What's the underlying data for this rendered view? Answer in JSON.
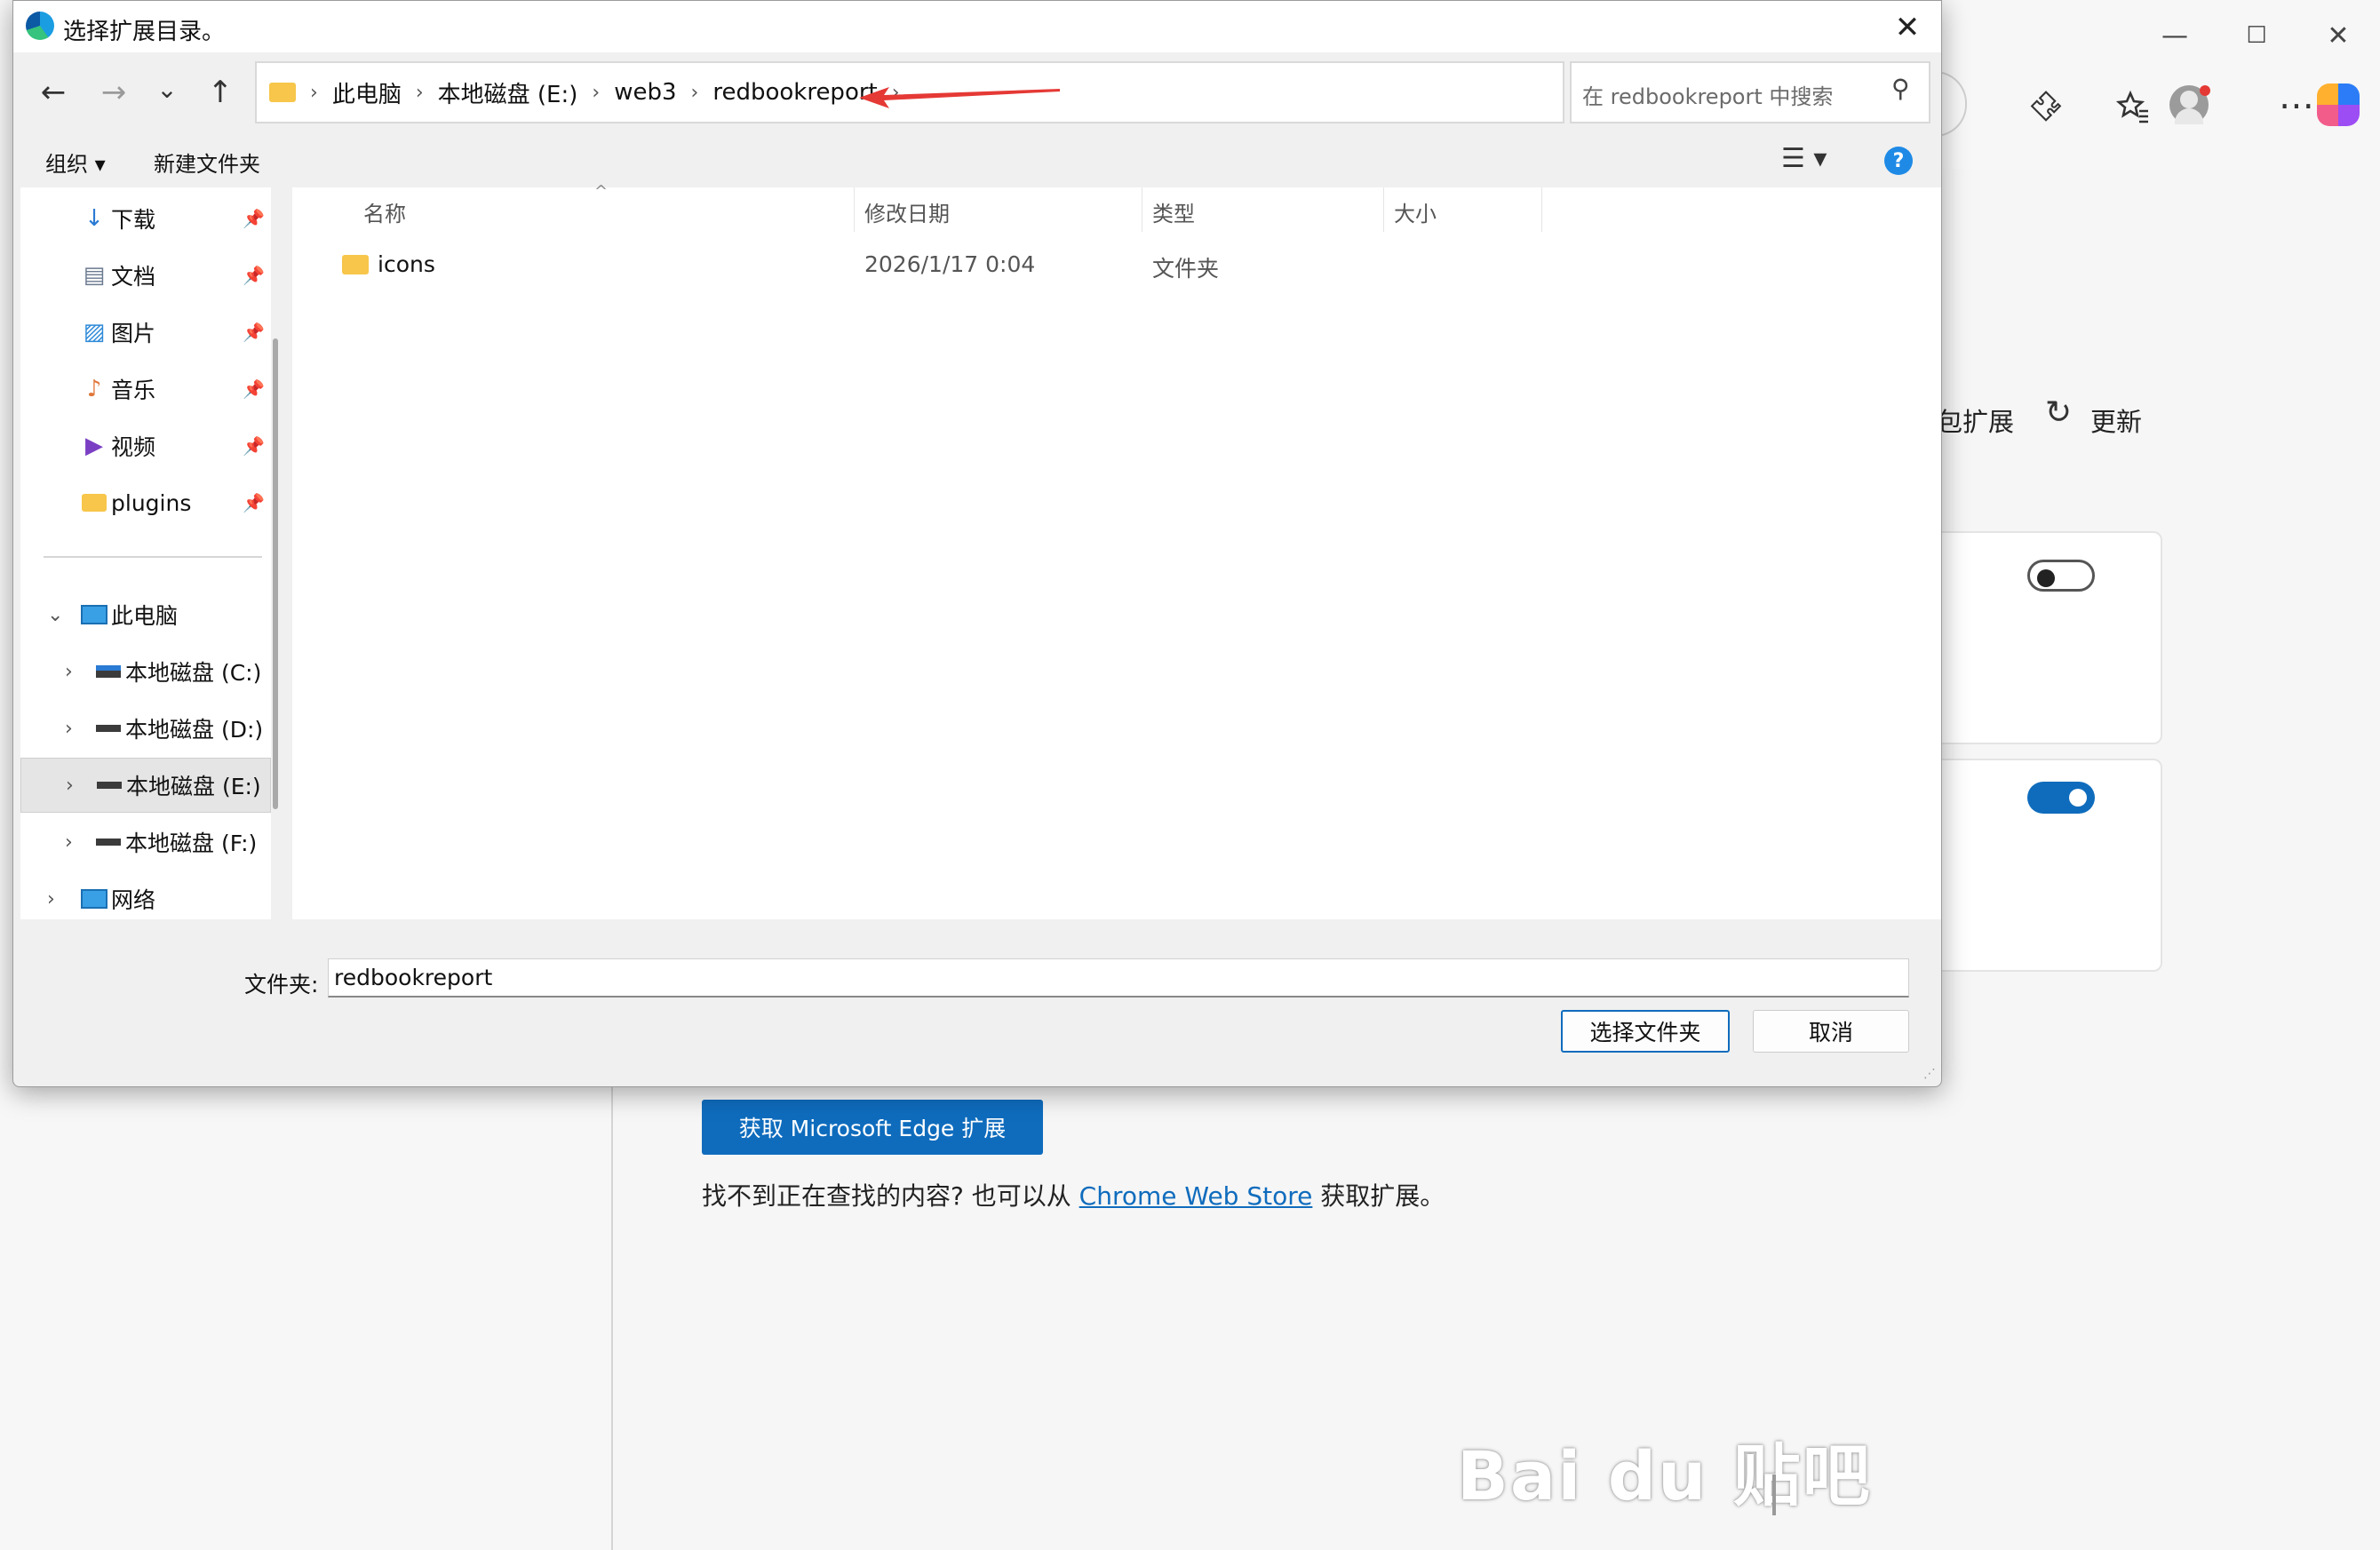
{
  "browser": {
    "window_controls": {
      "minimize": "—",
      "maximize": "☐",
      "close": "✕"
    },
    "toolbar_icons": [
      "extensions-icon",
      "favorites-icon",
      "profile-avatar",
      "more-icon",
      "copilot-icon"
    ],
    "more_glyph": "⋯"
  },
  "extensions_page": {
    "header_partial": "包扩展",
    "refresh_label": "更新",
    "refresh_glyph": "↻",
    "cards": [
      {
        "toggle": "off"
      },
      {
        "toggle": "on"
      }
    ],
    "get_extensions_button": "获取 Microsoft Edge 扩展",
    "not_found_prefix": "找不到正在查找的内容? 也可以从 ",
    "chrome_store_link": "Chrome Web Store",
    "not_found_suffix": " 获取扩展。",
    "accent_color": "#0f6cbd"
  },
  "watermark": "Bai du 贴吧",
  "dialog": {
    "title": "选择扩展目录。",
    "close_glyph": "✕",
    "nav": {
      "back": "←",
      "forward": "→",
      "recent": "⌄",
      "up": "↑"
    },
    "breadcrumb": [
      "此电脑",
      "本地磁盘 (E:)",
      "web3",
      "redbookreport"
    ],
    "breadcrumb_sep": "›",
    "address_dropdown": "⌄",
    "address_refresh": "↻",
    "search_placeholder": "在 redbookreport 中搜索",
    "search_glyph": "⚲",
    "toolbar": {
      "organize": "组织 ▾",
      "new_folder": "新建文件夹",
      "view": "☰ ▾",
      "help": "?"
    },
    "quick_access": [
      {
        "name": "下载",
        "icon": "↓"
      },
      {
        "name": "文档",
        "icon": "▤"
      },
      {
        "name": "图片",
        "icon": "▨"
      },
      {
        "name": "音乐",
        "icon": "♪"
      },
      {
        "name": "视频",
        "icon": "▶"
      },
      {
        "name": "plugins",
        "icon": ""
      }
    ],
    "pin_glyph": "📌",
    "this_pc": "此电脑",
    "drives": [
      "本地磁盘 (C:)",
      "本地磁盘 (D:)",
      "本地磁盘 (E:)",
      "本地磁盘 (F:)"
    ],
    "selected_drive": "本地磁盘 (E:)",
    "network": "网络",
    "columns": {
      "name": "名称",
      "modified": "修改日期",
      "type": "类型",
      "size": "大小"
    },
    "sort_caret": "^",
    "files": [
      {
        "name": "icons",
        "modified": "2026/1/17 0:04",
        "type": "文件夹",
        "size": ""
      }
    ],
    "folder_label": "文件夹:",
    "folder_value": "redbookreport",
    "select_button": "选择文件夹",
    "cancel_button": "取消"
  }
}
